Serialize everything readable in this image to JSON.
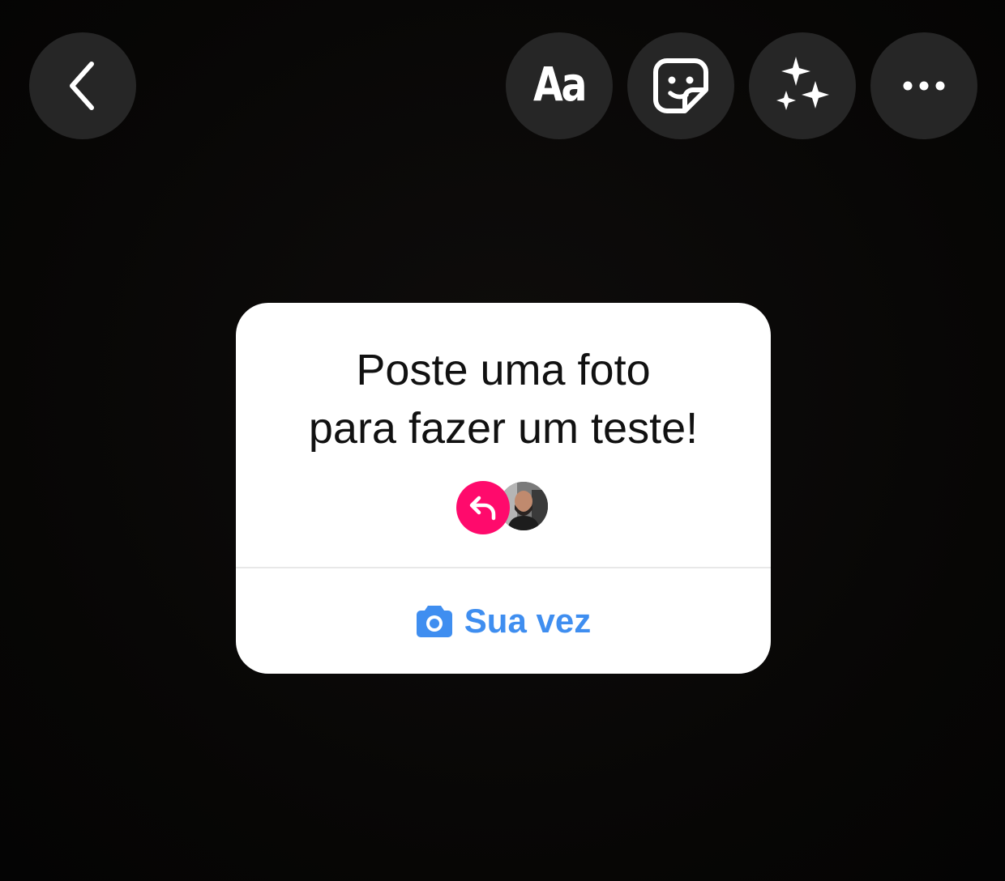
{
  "topbar": {
    "back_icon": "chevron-left-icon",
    "text_tool_label": "Aa",
    "sticker_icon": "sticker-icon",
    "effects_icon": "sparkles-icon",
    "more_icon": "more-horizontal-icon"
  },
  "sticker_card": {
    "prompt_line_1": "Poste uma foto",
    "prompt_line_2": "para fazer um teste!",
    "reply_icon": "reply-arrow-icon",
    "avatar": "user-avatar",
    "action_icon": "camera-icon",
    "action_label": "Sua vez"
  },
  "colors": {
    "background": "#080706",
    "button_bg": "#262626",
    "card_bg": "#ffffff",
    "accent_pink": "#ff0a6c",
    "action_blue": "#3f8ef0"
  }
}
